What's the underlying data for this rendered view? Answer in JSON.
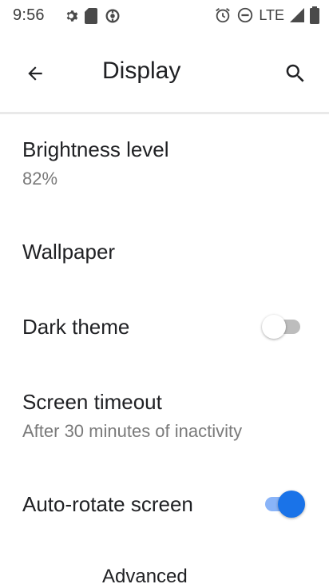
{
  "status_bar": {
    "time": "9:56",
    "network": "LTE",
    "icons": [
      "settings-icon",
      "sd-card-icon",
      "sync-icon",
      "alarm-icon",
      "do-not-disturb-icon",
      "signal-icon",
      "battery-icon"
    ]
  },
  "app_bar": {
    "title": "Display",
    "back_icon": "back-arrow-icon",
    "search_icon": "search-icon"
  },
  "settings": {
    "brightness": {
      "title": "Brightness level",
      "value": "82%"
    },
    "wallpaper": {
      "title": "Wallpaper"
    },
    "dark_theme": {
      "title": "Dark theme",
      "enabled": false
    },
    "screen_timeout": {
      "title": "Screen timeout",
      "value": "After 30 minutes of inactivity"
    },
    "auto_rotate": {
      "title": "Auto-rotate screen",
      "enabled": true
    },
    "advanced": {
      "title": "Advanced"
    }
  },
  "colors": {
    "accent": "#1a73e8",
    "accent_track": "#8ab4f8",
    "off_track": "#bdbdbd",
    "off_thumb": "#ffffff"
  }
}
